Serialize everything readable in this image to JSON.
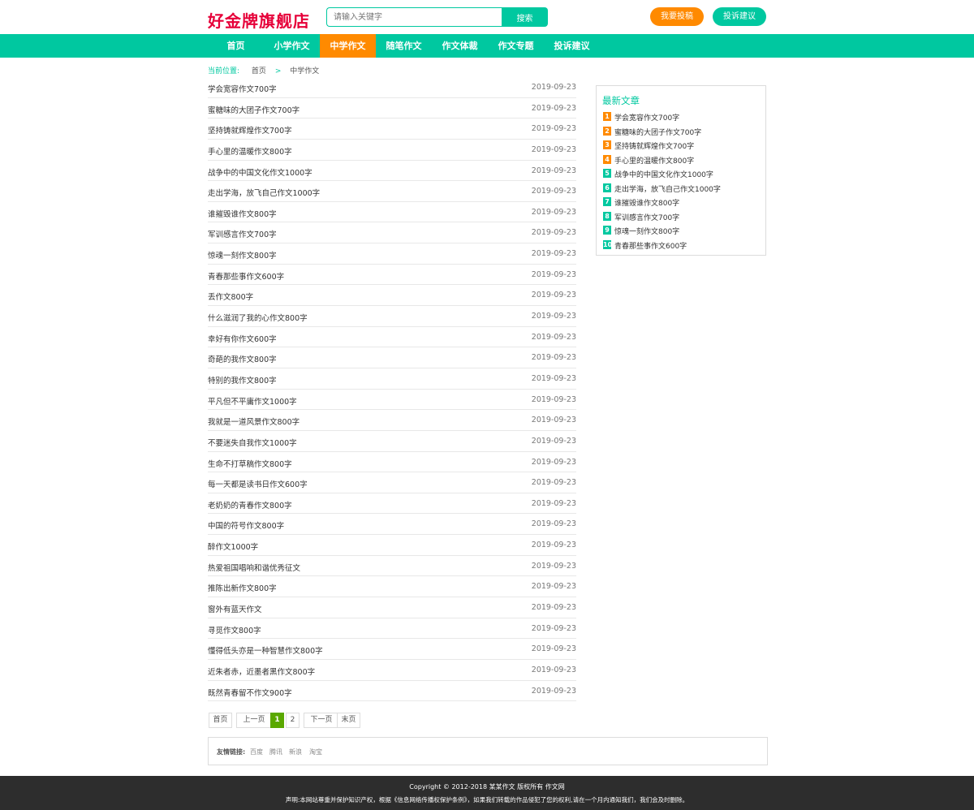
{
  "header": {
    "logo": "好金牌旗舰店",
    "search_placeholder": "请输入关键字",
    "search_button": "搜索",
    "submit_button": "我要投稿",
    "complaint_button": "投诉建议"
  },
  "nav": {
    "items": [
      {
        "label": "首页",
        "active": false
      },
      {
        "label": "小学作文",
        "active": false
      },
      {
        "label": "中学作文",
        "active": true
      },
      {
        "label": "随笔作文",
        "active": false
      },
      {
        "label": "作文体裁",
        "active": false
      },
      {
        "label": "作文专题",
        "active": false
      },
      {
        "label": "投诉建议",
        "active": false
      }
    ]
  },
  "breadcrumb": {
    "label": "当前位置:",
    "home": "首页",
    "separator": ">",
    "current": "中学作文"
  },
  "articles": [
    {
      "title": "学会宽容作文700字",
      "date": "2019-09-23"
    },
    {
      "title": "蜜糖味的大团子作文700字",
      "date": "2019-09-23"
    },
    {
      "title": "坚持铸就辉煌作文700字",
      "date": "2019-09-23"
    },
    {
      "title": "手心里的温暖作文800字",
      "date": "2019-09-23"
    },
    {
      "title": "战争中的中国文化作文1000字",
      "date": "2019-09-23"
    },
    {
      "title": "走出学海，放飞自己作文1000字",
      "date": "2019-09-23"
    },
    {
      "title": "谁摧毁谁作文800字",
      "date": "2019-09-23"
    },
    {
      "title": "军训感言作文700字",
      "date": "2019-09-23"
    },
    {
      "title": "惊魂一刻作文800字",
      "date": "2019-09-23"
    },
    {
      "title": "青春那些事作文600字",
      "date": "2019-09-23"
    },
    {
      "title": "丢作文800字",
      "date": "2019-09-23"
    },
    {
      "title": "什么滋润了我的心作文800字",
      "date": "2019-09-23"
    },
    {
      "title": "幸好有你作文600字",
      "date": "2019-09-23"
    },
    {
      "title": "奇葩的我作文800字",
      "date": "2019-09-23"
    },
    {
      "title": "特别的我作文800字",
      "date": "2019-09-23"
    },
    {
      "title": "平凡但不平庸作文1000字",
      "date": "2019-09-23"
    },
    {
      "title": "我就是一道风景作文800字",
      "date": "2019-09-23"
    },
    {
      "title": "不要迷失自我作文1000字",
      "date": "2019-09-23"
    },
    {
      "title": "生命不打草稿作文800字",
      "date": "2019-09-23"
    },
    {
      "title": "每一天都是读书日作文600字",
      "date": "2019-09-23"
    },
    {
      "title": "老奶奶的青春作文800字",
      "date": "2019-09-23"
    },
    {
      "title": "中国的符号作文800字",
      "date": "2019-09-23"
    },
    {
      "title": "醉作文1000字",
      "date": "2019-09-23"
    },
    {
      "title": "热爱祖国唱响和谐优秀征文",
      "date": "2019-09-23"
    },
    {
      "title": "推陈出新作文800字",
      "date": "2019-09-23"
    },
    {
      "title": "窗外有蓝天作文",
      "date": "2019-09-23"
    },
    {
      "title": "寻觅作文800字",
      "date": "2019-09-23"
    },
    {
      "title": "懂得低头亦是一种智慧作文800字",
      "date": "2019-09-23"
    },
    {
      "title": "近朱者赤，近墨者黑作文800字",
      "date": "2019-09-23"
    },
    {
      "title": "既然青春留不作文900字",
      "date": "2019-09-23"
    }
  ],
  "pagination": {
    "first": "首页",
    "prev": "上一页",
    "pages": [
      "1",
      "2"
    ],
    "current_page": "1",
    "next": "下一页",
    "last": "末页"
  },
  "sidebar": {
    "title": "最新文章",
    "items": [
      {
        "num": "1",
        "title": "学会宽容作文700字",
        "color": "#ff8a00"
      },
      {
        "num": "2",
        "title": "蜜糖味的大团子作文700字",
        "color": "#ff8a00"
      },
      {
        "num": "3",
        "title": "坚持铸就辉煌作文700字",
        "color": "#ff8a00"
      },
      {
        "num": "4",
        "title": "手心里的温暖作文800字",
        "color": "#ff8a00"
      },
      {
        "num": "5",
        "title": "战争中的中国文化作文1000字",
        "color": "#00c8a0"
      },
      {
        "num": "6",
        "title": "走出学海，放飞自己作文1000字",
        "color": "#00c8a0"
      },
      {
        "num": "7",
        "title": "谁摧毁谁作文800字",
        "color": "#00c8a0"
      },
      {
        "num": "8",
        "title": "军训感言作文700字",
        "color": "#00c8a0"
      },
      {
        "num": "9",
        "title": "惊魂一刻作文800字",
        "color": "#00c8a0"
      },
      {
        "num": "10",
        "title": "青春那些事作文600字",
        "color": "#00c8a0"
      }
    ]
  },
  "friend_links": {
    "label": "友情链接:",
    "items": [
      "百度",
      "腾讯",
      "新浪",
      "淘宝"
    ]
  },
  "footer": {
    "copyright": "Copyright © 2012-2018 某某作文 版权所有   作文网",
    "declaration": "声明:本网站尊重并保护知识产权，根据《信息网络传播权保护条例》，如果我们转载的作品侵犯了您的权利,请在一个月内通知我们，我们会及时删除。"
  },
  "colors": {
    "accent": "#00c8a0",
    "orange": "#ff8a00",
    "logo": "#e60039",
    "footer_bg": "#2d2d2d",
    "page_current": "#5aa800"
  }
}
